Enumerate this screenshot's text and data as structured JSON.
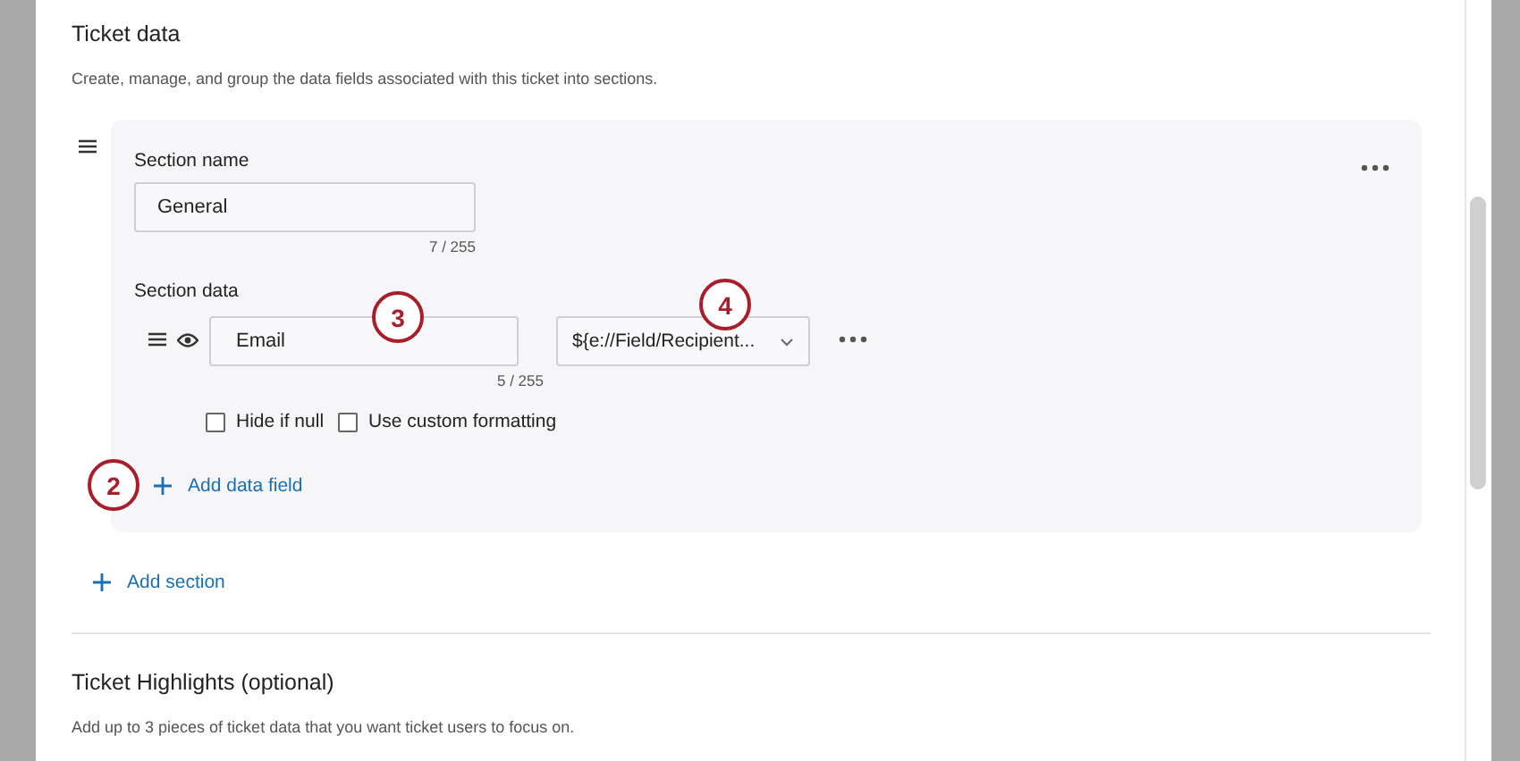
{
  "ticket_data": {
    "title": "Ticket data",
    "description": "Create, manage, and group the data fields associated with this ticket into sections."
  },
  "section": {
    "name_label": "Section name",
    "name_value": "General",
    "name_counter": "7 / 255",
    "data_label": "Section data",
    "field": {
      "name_value": "Email",
      "counter": "5 / 255",
      "source_value": "${e://Field/Recipient..."
    },
    "options": [
      {
        "label": "Hide if null",
        "checked": false
      },
      {
        "label": "Use custom formatting",
        "checked": false
      }
    ],
    "add_field": "Add data field"
  },
  "add_section": "Add section",
  "highlights": {
    "title": "Ticket Highlights (optional)",
    "description": "Add up to 3 pieces of ticket data that you want ticket users to focus on."
  },
  "callouts": [
    {
      "number": "2"
    },
    {
      "number": "3"
    },
    {
      "number": "4"
    }
  ]
}
